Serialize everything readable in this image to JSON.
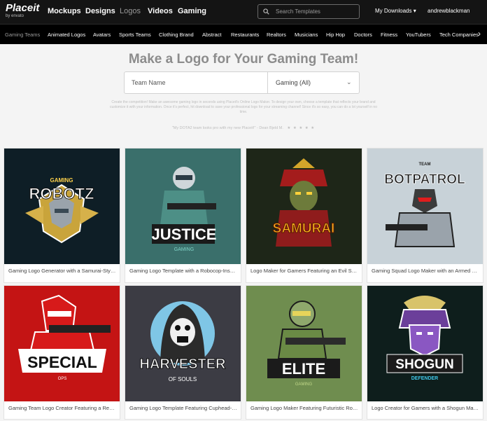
{
  "brand": {
    "name": "Placeit",
    "by": "by envato"
  },
  "nav": {
    "links": [
      "Mockups",
      "Designs",
      "Logos",
      "Videos",
      "Gaming"
    ],
    "search_placeholder": "Search Templates",
    "my_downloads": "My Downloads ▾",
    "username": "andrewblackman"
  },
  "subnav": {
    "items": [
      "Gaming Teams",
      "Animated Logos",
      "Avatars",
      "Sports Teams",
      "Clothing Brand",
      "Abstract",
      "Restaurants",
      "Realtors",
      "Musicians",
      "Hip Hop",
      "Doctors",
      "Fitness",
      "YouTubers",
      "Tech Companies"
    ],
    "next_arrow": "›"
  },
  "hero": {
    "title": "Make a Logo for Your Gaming Team!",
    "team_name_placeholder": "Team Name",
    "category_value": "Gaming (All)",
    "category_chevron": "⌄",
    "description": "Create the competition! Make an awesome gaming logo in seconds using Placeit's Online Logo Maker. To design your own, choose a template that reflects your brand and customize it with your information. Once it's perfect, hit download to save your professional logo for your streaming channel! Since it's so easy, you can do a lot yourself in no time.",
    "review_quote": "\"My DOTA2 team looks pro with my new Placeit!\" - Dean Bjeld M.",
    "review_stars": "★ ★ ★ ★ ★"
  },
  "colors": {
    "topbar": "#141414",
    "subbar": "#000000",
    "page_bg": "#f4f4f4"
  },
  "cards": [
    {
      "logo_text": "ROBOTZ",
      "logo_sub": "GAMING",
      "bg": "#0e1e26",
      "caption": "Gaming Logo Generator with a Samurai-Style Robot..."
    },
    {
      "logo_text": "JUSTICE",
      "logo_sub": "GAMING",
      "bg": "#3a6f6b",
      "caption": "Gaming Logo Template with a Robocop-Inspired Character..."
    },
    {
      "logo_text": "SAMURAI",
      "logo_sub": "",
      "bg": "#1e2618",
      "caption": "Logo Maker for Gamers Featuring an Evil Samurai..."
    },
    {
      "logo_text": "BOTPATROL",
      "logo_sub": "TEAM",
      "bg": "#c8d2d8",
      "caption": "Gaming Squad Logo Maker with an Armed Mecha..."
    },
    {
      "logo_text": "SPECIAL",
      "logo_sub": "OPS",
      "bg": "#c41414",
      "caption": "Gaming Team Logo Creator Featuring a Red Robot..."
    },
    {
      "logo_text": "HARVESTER",
      "logo_sub": "OF SOULS",
      "bg": "#3c3c44",
      "caption": "Gaming Logo Template Featuring Cuphead-Inspired Reaper..."
    },
    {
      "logo_text": "ELITE",
      "logo_sub": "GAMING",
      "bg": "#6f8d4f",
      "caption": "Gaming Logo Maker Featuring Futuristic Robot Soldier..."
    },
    {
      "logo_text": "SHOGUN",
      "logo_sub": "DEFENDER",
      "bg": "#0e1e1c",
      "caption": "Logo Creator for Gamers with a Shogun Mask..."
    }
  ]
}
